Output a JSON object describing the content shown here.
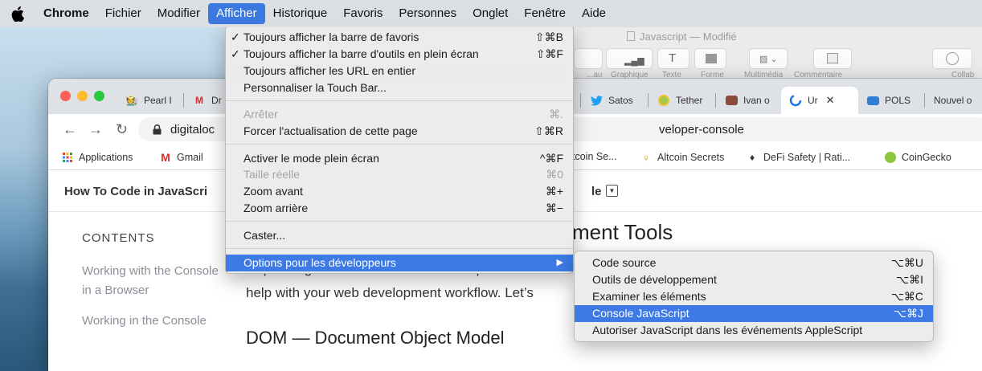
{
  "menubar": {
    "items": [
      {
        "label": "Chrome",
        "bold": true
      },
      {
        "label": "Fichier"
      },
      {
        "label": "Modifier"
      },
      {
        "label": "Afficher",
        "active": true
      },
      {
        "label": "Historique"
      },
      {
        "label": "Favoris"
      },
      {
        "label": "Personnes"
      },
      {
        "label": "Onglet"
      },
      {
        "label": "Fenêtre"
      },
      {
        "label": "Aide"
      }
    ]
  },
  "pages_window": {
    "title": "Javascript — Modifié",
    "toolbar_labels": [
      "...au",
      "Graphique",
      "Texte",
      "Forme",
      "Multimédia",
      "Commentaire",
      "Collab"
    ]
  },
  "chrome": {
    "tabs": [
      {
        "label": "Pearl I",
        "icon": "person-icon"
      },
      {
        "label": "Dr",
        "icon": "gmail-icon"
      },
      {
        "label": "Satos",
        "icon": "twitter-icon"
      },
      {
        "label": "Tether",
        "icon": "coin-icon"
      },
      {
        "label": "Ivan o",
        "icon": "video-icon"
      },
      {
        "label": "Ur",
        "icon": "spinner-icon",
        "active": true
      },
      {
        "label": "POLS",
        "icon": "cloud-icon"
      },
      {
        "label": "Nouvel o",
        "icon": ""
      }
    ],
    "url_visible": "digitaloc",
    "url_tail": "veloper-console",
    "bookmarks": [
      {
        "label": "Applications",
        "icon": "apps-grid-icon"
      },
      {
        "label": "Gmail",
        "icon": "gmail-icon"
      },
      {
        "label": "tcoin Se...",
        "icon": ""
      },
      {
        "label": "Altcoin Secrets",
        "icon": "person-icon"
      },
      {
        "label": "DeFi Safety | Rati...",
        "icon": "defi-icon"
      },
      {
        "label": "CoinGecko",
        "icon": "gecko-icon"
      }
    ],
    "article": {
      "title": "How To Code in JavaScri",
      "title_tail": "le",
      "toc_heading": "CONTENTS",
      "toc_items": [
        "Working with the Console in a Browser",
        "Working in the Console"
      ],
      "heading_visible": "ment Tools",
      "para_line1": "Depending on which browser’s development too",
      "para_line2": "help with your web development workflow. Let’s",
      "heading2": "DOM — Document Object Model"
    }
  },
  "afficher_menu": {
    "groups": [
      [
        {
          "label": "Toujours afficher la barre de favoris",
          "shortcut": "⇧⌘B",
          "checked": true
        },
        {
          "label": "Toujours afficher la barre d'outils en plein écran",
          "shortcut": "⇧⌘F",
          "checked": true
        },
        {
          "label": "Toujours afficher les URL en entier",
          "shortcut": ""
        },
        {
          "label": "Personnaliser la Touch Bar...",
          "shortcut": ""
        }
      ],
      [
        {
          "label": "Arrêter",
          "shortcut": "⌘.",
          "disabled": true
        },
        {
          "label": "Forcer l'actualisation de cette page",
          "shortcut": "⇧⌘R"
        }
      ],
      [
        {
          "label": "Activer le mode plein écran",
          "shortcut": "^⌘F"
        },
        {
          "label": "Taille réelle",
          "shortcut": "⌘0",
          "disabled": true
        },
        {
          "label": "Zoom avant",
          "shortcut": "⌘+"
        },
        {
          "label": "Zoom arrière",
          "shortcut": "⌘−"
        }
      ],
      [
        {
          "label": "Caster...",
          "shortcut": ""
        }
      ],
      [
        {
          "label": "Options pour les développeurs",
          "shortcut": "▶",
          "highlighted": true
        }
      ]
    ]
  },
  "dev_submenu": {
    "items": [
      {
        "label": "Code source",
        "shortcut": "⌥⌘U"
      },
      {
        "label": "Outils de développement",
        "shortcut": "⌥⌘I"
      },
      {
        "label": "Examiner les éléments",
        "shortcut": "⌥⌘C"
      },
      {
        "label": "Console JavaScript",
        "shortcut": "⌥⌘J",
        "highlighted": true
      },
      {
        "label": "Autoriser JavaScript dans les événements AppleScript",
        "shortcut": ""
      }
    ]
  },
  "colors": {
    "menu_highlight": "#3d7ae5",
    "menubar_active": "#3b78e0",
    "traffic_red": "#fe5f57",
    "traffic_yellow": "#febc2e",
    "traffic_green": "#28c840"
  }
}
